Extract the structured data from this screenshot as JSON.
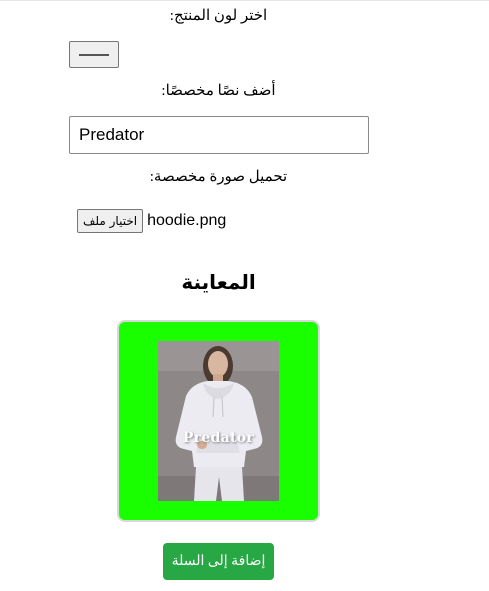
{
  "form": {
    "color_label": "اختر لون المنتج:",
    "text_label": "أضف نصًا مخصصًا:",
    "text_value": "Predator",
    "upload_label": "تحميل صورة مخصصة:",
    "file_button_label": "اختيار ملف",
    "file_name": "hoodie.png"
  },
  "preview": {
    "title": "المعاينة",
    "overlay_text": "Predator"
  },
  "actions": {
    "add_to_cart_label": "إضافة إلى السلة"
  },
  "colors": {
    "preview_background": "#1aff00",
    "cart_button": "#28a745"
  },
  "icons": {
    "color_picker": "color-swatch-icon"
  }
}
